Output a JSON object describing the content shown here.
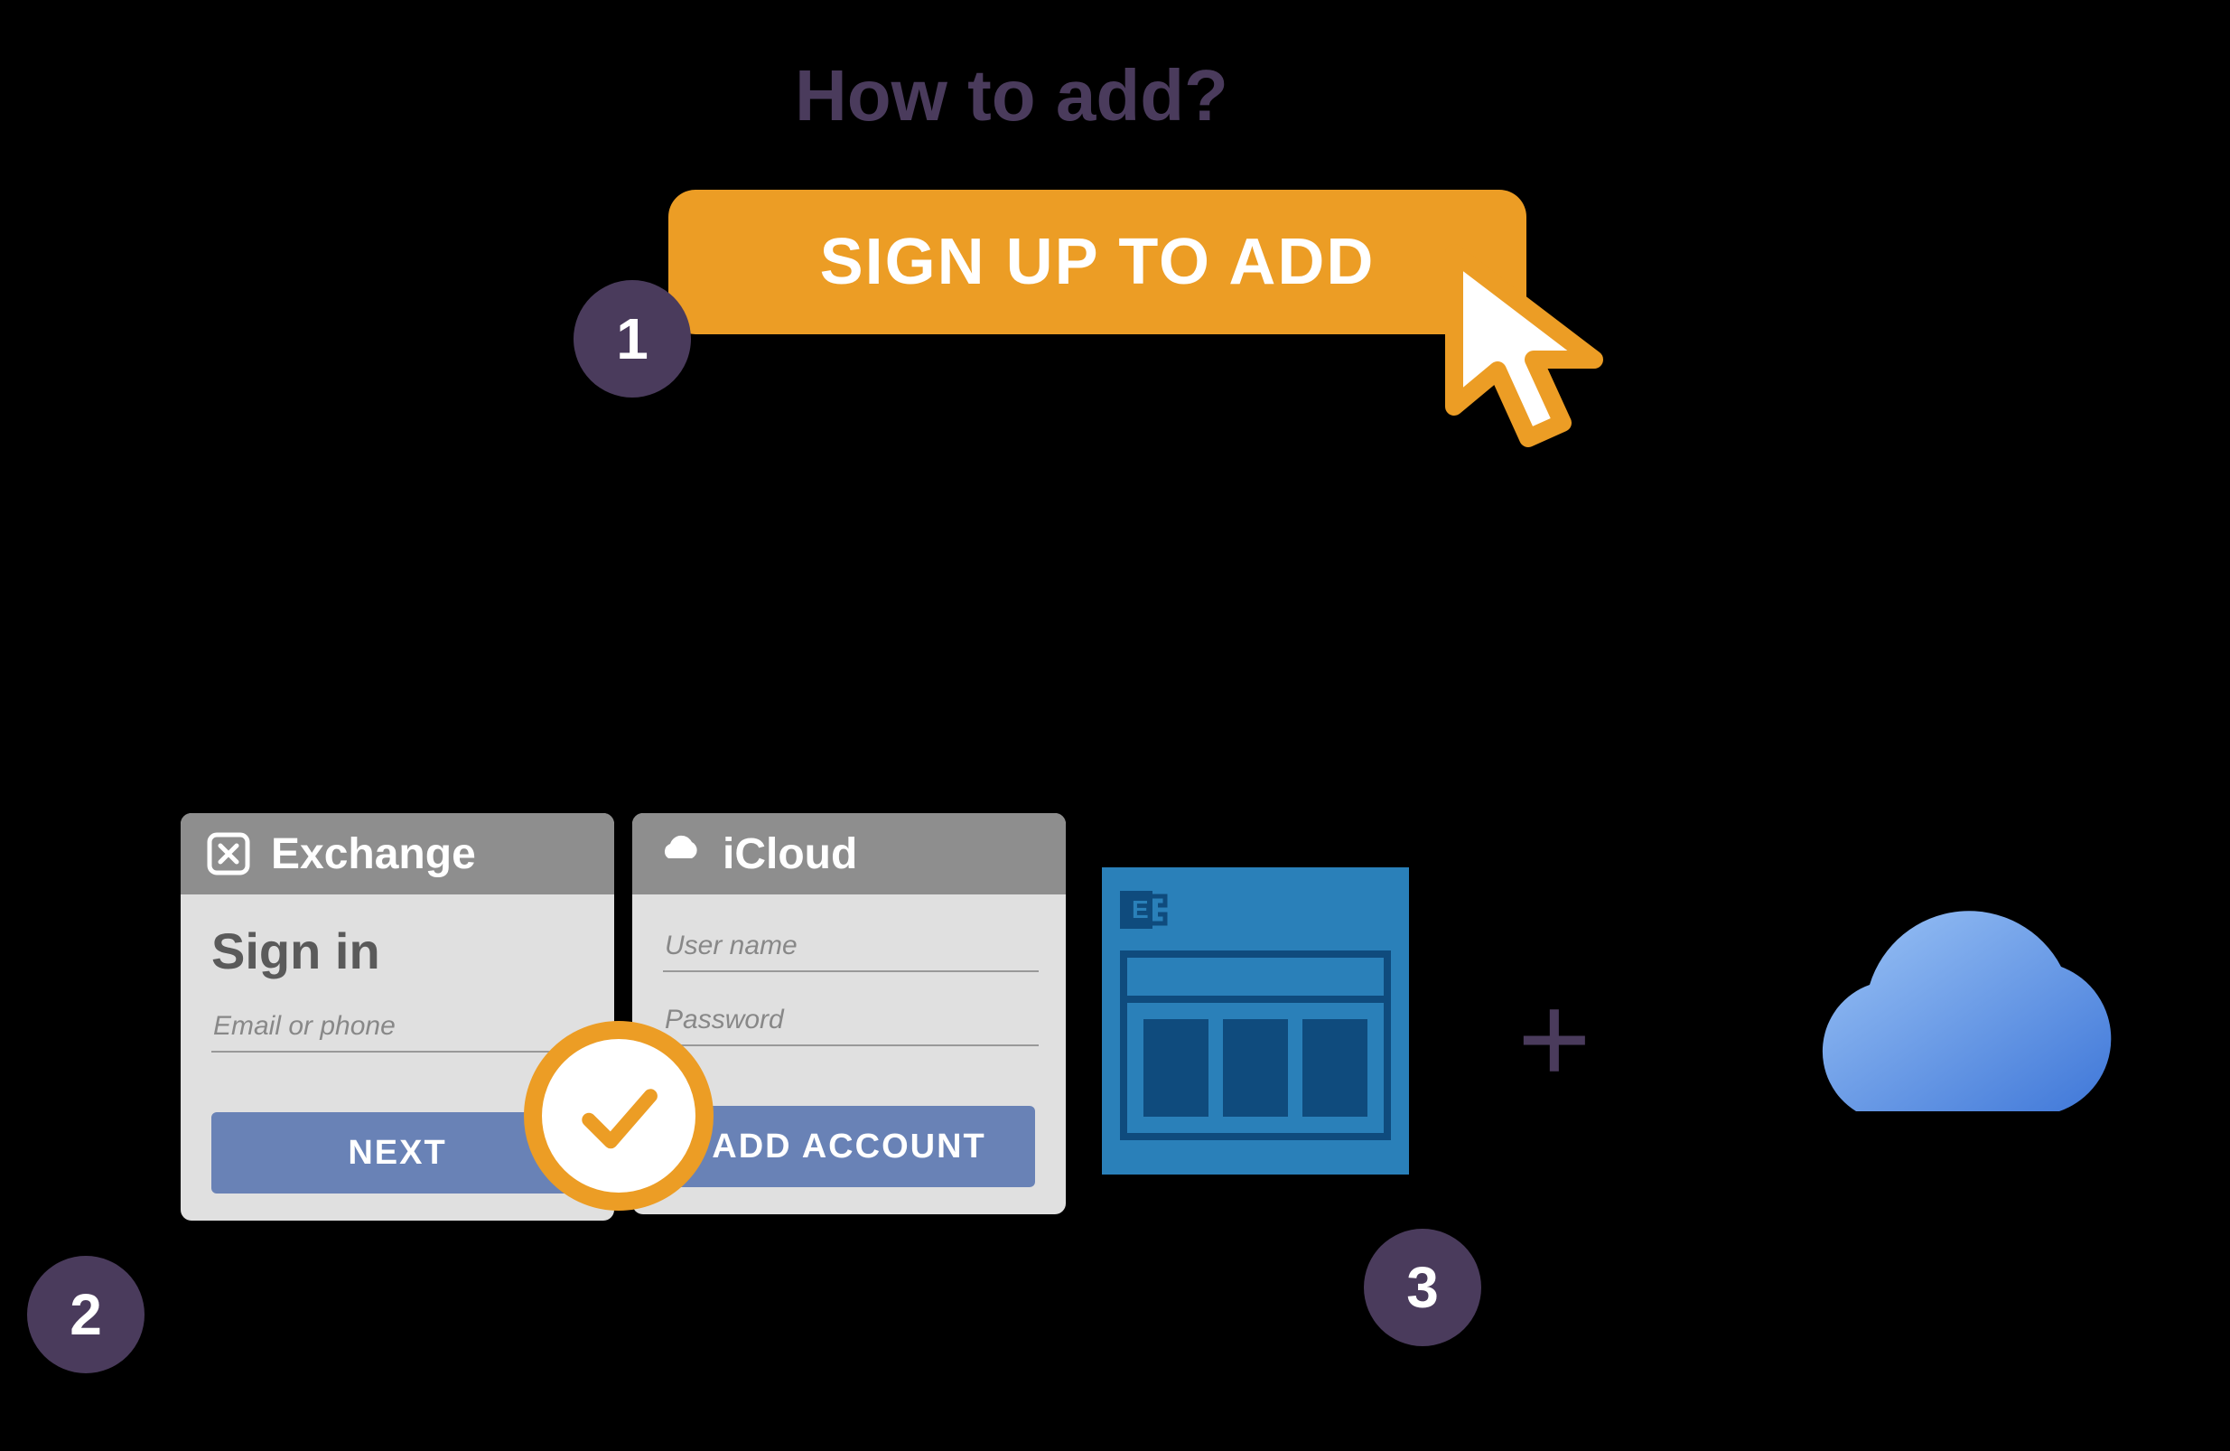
{
  "title": "How to add?",
  "steps": {
    "one": "1",
    "two": "2",
    "three": "3"
  },
  "signup_button": "SIGN UP TO ADD",
  "exchange_card": {
    "header": "Exchange",
    "signin_label": "Sign in",
    "placeholder": "Email or phone",
    "button": "NEXT"
  },
  "icloud_card": {
    "header": "iCloud",
    "user_placeholder": "User name",
    "pass_placeholder": "Password",
    "button": "ADD ACCOUNT"
  },
  "plus": "+"
}
